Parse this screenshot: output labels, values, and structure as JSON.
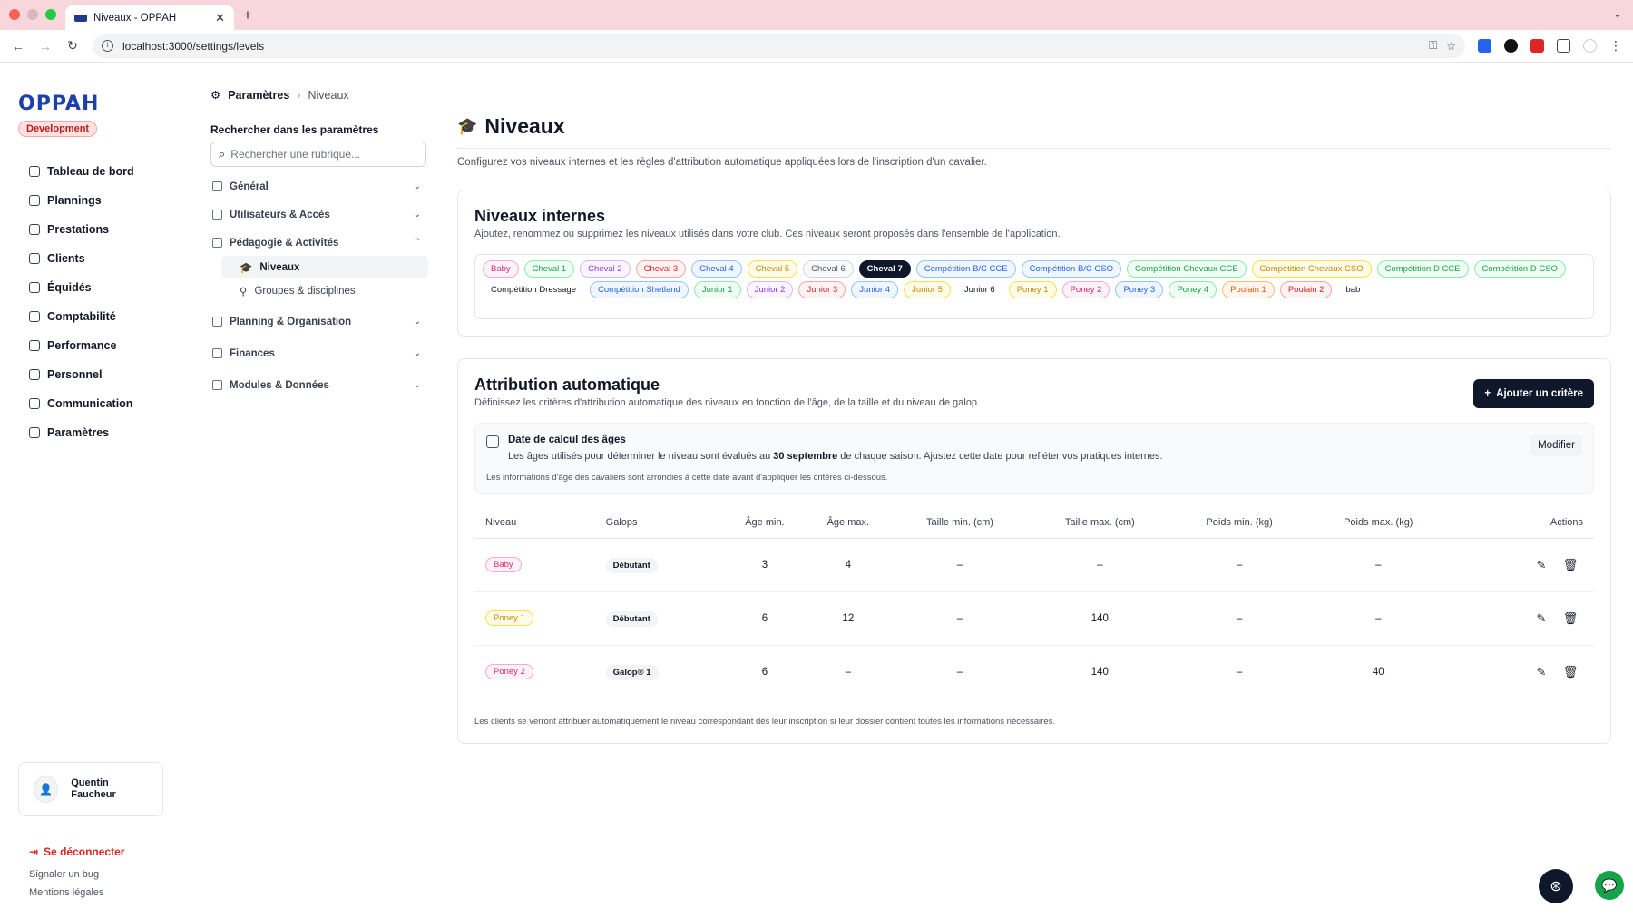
{
  "browser": {
    "tab_title": "Niveaux - OPPAH",
    "url": "localhost:3000/settings/levels"
  },
  "sidebar": {
    "logo": "OPPAH",
    "env_badge": "Development",
    "items": [
      {
        "label": "Tableau de bord",
        "icon": "home-icon"
      },
      {
        "label": "Plannings",
        "icon": "calendar-icon"
      },
      {
        "label": "Prestations",
        "icon": "services-icon"
      },
      {
        "label": "Clients",
        "icon": "contacts-icon"
      },
      {
        "label": "Équidés",
        "icon": "horse-icon"
      },
      {
        "label": "Comptabilité",
        "icon": "bank-icon"
      },
      {
        "label": "Performance",
        "icon": "chart-icon"
      },
      {
        "label": "Personnel",
        "icon": "users-icon"
      },
      {
        "label": "Communication",
        "icon": "mail-icon"
      },
      {
        "label": "Paramètres",
        "icon": "gear-icon"
      }
    ],
    "user_name": "Quentin Faucheur",
    "logout": "Se déconnecter",
    "report_bug": "Signaler un bug",
    "legal": "Mentions légales"
  },
  "settings_nav": {
    "breadcrumb_root": "Paramètres",
    "breadcrumb_current": "Niveaux",
    "search_label": "Rechercher dans les paramètres",
    "search_placeholder": "Rechercher une rubrique...",
    "groups": {
      "general": "Général",
      "users": "Utilisateurs & Accès",
      "pedagogy": "Pédagogie & Activités",
      "planning": "Planning & Organisation",
      "finances": "Finances",
      "modules": "Modules & Données"
    },
    "pedagogy_items": {
      "levels": "Niveaux",
      "groups": "Groupes & disciplines"
    }
  },
  "page": {
    "title": "Niveaux",
    "description": "Configurez vos niveaux internes et les règles d'attribution automatique appliquées lors de l'inscription d'un cavalier."
  },
  "levels_card": {
    "title": "Niveaux internes",
    "description": "Ajoutez, renommez ou supprimez les niveaux utilisés dans votre club. Ces niveaux seront proposés dans l'ensemble de l'application.",
    "chips": [
      {
        "label": "Baby",
        "color": "pink"
      },
      {
        "label": "Cheval 1",
        "color": "green"
      },
      {
        "label": "Cheval 2",
        "color": "purple"
      },
      {
        "label": "Cheval 3",
        "color": "red"
      },
      {
        "label": "Cheval 4",
        "color": "blue"
      },
      {
        "label": "Cheval 5",
        "color": "yellow"
      },
      {
        "label": "Cheval 6",
        "color": "gray"
      },
      {
        "label": "Cheval 7",
        "color": "dark"
      },
      {
        "label": "Compétition B/C CCE",
        "color": "blue"
      },
      {
        "label": "Compétition B/C CSO",
        "color": "blue"
      },
      {
        "label": "Compétition Chevaux CCE",
        "color": "green"
      },
      {
        "label": "Compétition Chevaux CSO",
        "color": "yellow"
      },
      {
        "label": "Compétition D CCE",
        "color": "green"
      },
      {
        "label": "Compétition D CSO",
        "color": "green"
      },
      {
        "label": "Compétition Dressage",
        "color": "plain"
      },
      {
        "label": "Compétition Shetland",
        "color": "blue"
      },
      {
        "label": "Junior 1",
        "color": "green"
      },
      {
        "label": "Junior 2",
        "color": "purple"
      },
      {
        "label": "Junior 3",
        "color": "red"
      },
      {
        "label": "Junior 4",
        "color": "blue"
      },
      {
        "label": "Junior 5",
        "color": "yellow"
      },
      {
        "label": "Junior 6",
        "color": "plain"
      },
      {
        "label": "Poney 1",
        "color": "yellow"
      },
      {
        "label": "Poney 2",
        "color": "pink"
      },
      {
        "label": "Poney 3",
        "color": "blue"
      },
      {
        "label": "Poney 4",
        "color": "green"
      },
      {
        "label": "Poulain 1",
        "color": "orange"
      },
      {
        "label": "Poulain 2",
        "color": "red"
      },
      {
        "label": "bab",
        "color": "plain"
      }
    ]
  },
  "auto_card": {
    "title": "Attribution automatique",
    "description": "Définissez les critères d'attribution automatique des niveaux en fonction de l'âge, de la taille et du niveau de galop.",
    "add_button": "Ajouter un critère",
    "info_title": "Date de calcul des âges",
    "info_text_before": "Les âges utilisés pour déterminer le niveau sont évalués au ",
    "info_date": "30 septembre",
    "info_text_after": " de chaque saison. Ajustez cette date pour refléter vos pratiques internes.",
    "info_note": "Les informations d'âge des cavaliers sont arrondies à cette date avant d'appliquer les critères ci-dessous.",
    "modify_button": "Modifier",
    "columns": [
      "Niveau",
      "Galops",
      "Âge min.",
      "Âge max.",
      "Taille min. (cm)",
      "Taille max. (cm)",
      "Poids min. (kg)",
      "Poids max. (kg)",
      "Actions"
    ],
    "rows": [
      {
        "level": "Baby",
        "color": "pink",
        "galop": "Débutant",
        "age_min": "3",
        "age_max": "4",
        "height_min": "–",
        "height_max": "–",
        "weight_min": "–",
        "weight_max": "–"
      },
      {
        "level": "Poney 1",
        "color": "yellow",
        "galop": "Débutant",
        "age_min": "6",
        "age_max": "12",
        "height_min": "–",
        "height_max": "140",
        "weight_min": "–",
        "weight_max": "–"
      },
      {
        "level": "Poney 2",
        "color": "pink",
        "galop": "Galop® 1",
        "age_min": "6",
        "age_max": "–",
        "height_min": "–",
        "height_max": "140",
        "weight_min": "–",
        "weight_max": "40"
      }
    ],
    "footer_note": "Les clients se verront attribuer automatiquement le niveau correspondant dès leur inscription si leur dossier contient toutes les informations nécessaires."
  }
}
